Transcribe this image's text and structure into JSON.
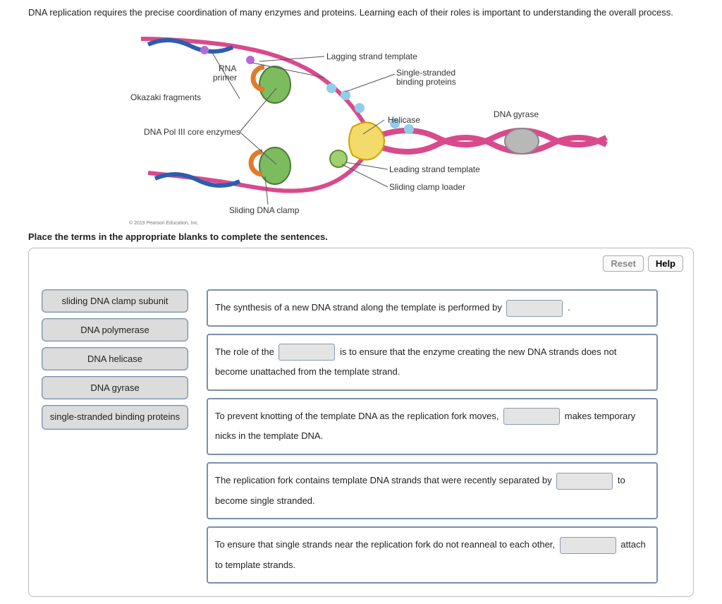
{
  "intro": "DNA replication requires the precise coordination of many enzymes and proteins. Learning each of their roles is important to understanding the overall process.",
  "diagram": {
    "labels": {
      "okazaki": "Okazaki fragments",
      "rna_primer_1": "RNA",
      "rna_primer_2": "primer",
      "lagging": "Lagging strand template",
      "ssbp_1": "Single-stranded",
      "ssbp_2": "binding proteins",
      "pol3": "DNA Pol III core enzymes",
      "helicase": "Helicase",
      "gyrase": "DNA gyrase",
      "leading": "Leading strand template",
      "loader": "Sliding clamp loader",
      "clamp": "Sliding DNA clamp"
    },
    "copyright": "© 2019 Pearson Education, Inc."
  },
  "instruction": "Place the terms in the appropriate blanks to complete the sentences.",
  "buttons": {
    "reset": "Reset",
    "help": "Help"
  },
  "terms": [
    "sliding DNA clamp subunit",
    "DNA polymerase",
    "DNA helicase",
    "DNA gyrase",
    "single-stranded binding proteins"
  ],
  "sentences": {
    "s1a": "The synthesis of a new DNA strand along the template is performed by ",
    "s1b": " .",
    "s2a": "The role of the ",
    "s2b": " is to ensure that the enzyme creating the new DNA strands does not become unattached from the template strand.",
    "s3a": "To prevent knotting of the template DNA as the replication fork moves, ",
    "s3b": " makes temporary nicks in the template DNA.",
    "s4a": "The replication fork contains template DNA strands that were recently separated by ",
    "s4b": " to become single stranded.",
    "s5a": "To ensure that single strands near the replication fork do not reanneal to each other, ",
    "s5b": " attach to template strands."
  }
}
